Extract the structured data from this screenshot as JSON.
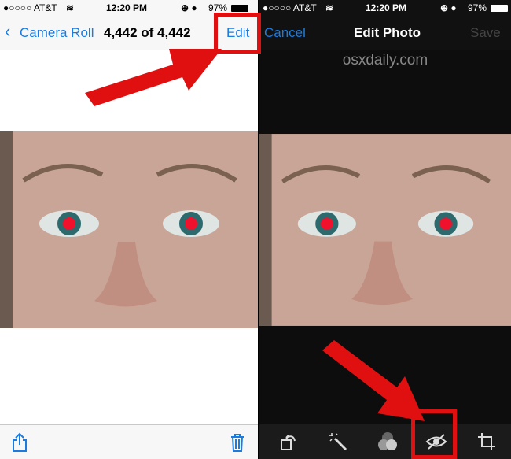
{
  "left_screen": {
    "status": {
      "carrier": "●○○○○ AT&T",
      "wifi": "wifi-icon",
      "time": "12:20 PM",
      "battery": "97%"
    },
    "nav": {
      "back_label": "Camera Roll",
      "title": "4,442 of 4,442",
      "edit_label": "Edit"
    },
    "toolbar": {
      "share": "share-icon",
      "trash": "trash-icon"
    }
  },
  "right_screen": {
    "status": {
      "carrier": "●○○○○ AT&T",
      "wifi": "wifi-icon",
      "time": "12:20 PM",
      "battery": "97%"
    },
    "nav": {
      "cancel_label": "Cancel",
      "title": "Edit Photo",
      "save_label": "Save"
    },
    "watermark": "osxdaily.com",
    "toolbar": [
      "rotate-icon",
      "auto-enhance-icon",
      "filters-icon",
      "red-eye-icon",
      "crop-icon"
    ]
  },
  "colors": {
    "accent": "#1a7ce0",
    "highlight": "#e01010"
  }
}
